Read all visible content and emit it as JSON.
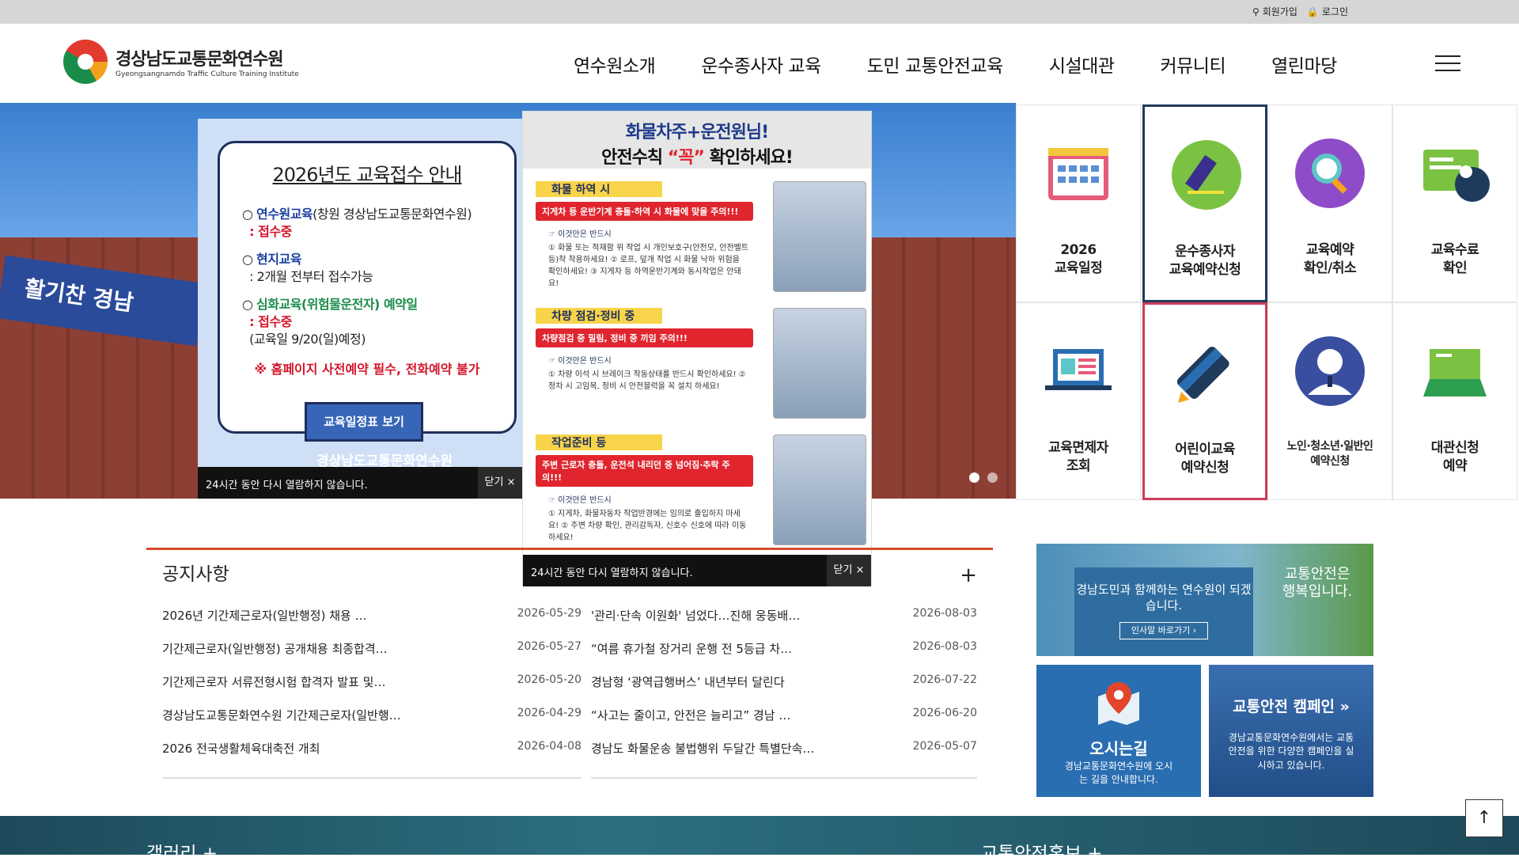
{
  "topbar": {
    "join": "회원가입",
    "login": "로그인"
  },
  "logo": {
    "title": "경상남도교통문화연수원",
    "subtitle": "Gyeongsangnamdo Traffic Culture Training Institute"
  },
  "nav": [
    "연수원소개",
    "운수종사자 교육",
    "도민 교통안전교육",
    "시설대관",
    "커뮤니티",
    "열린마당"
  ],
  "hero": {
    "sign_text": "활기찬 경남"
  },
  "popup1": {
    "title": "2026년도 교육접수 안내",
    "item1_label": "연수원교육",
    "item1_extra": "(창원 경상남도교통문화연수원)",
    "item1_status": ": 접수중",
    "item2_label": "현지교육",
    "item2_status": ": 2개월 전부터 접수가능",
    "item3_label": "심화교육(위험물운전자) 예약일",
    "item3_status": ": 접수중",
    "item3_note": "(교육일 9/20(일)예정)",
    "warning": "※ 홈페이지 사전예약 필수, 전화예약 불가",
    "button": "교육일정표 보기",
    "org": "경상남도교통문화연수원",
    "close_msg": "24시간 동안 다시 열람하지 않습니다.",
    "close_label": "닫기 ×"
  },
  "popup2": {
    "head1": "화물차주+운전원님!",
    "head2_pre": "안전수칙 ",
    "head2_emph": "“꼭”",
    "head2_post": " 확인하세요!",
    "sections": [
      {
        "title": "화물 하역 시",
        "bar": "지게차 등 운반기계 충돌·하역 시 화물에 맞을 주의!!!",
        "sub": "☞ 이것만은 반드시",
        "body": "① 화물 또는 적재함 위 작업 시 개인보호구(안전모, 안전벨트 등)착 착용하세요! ② 로프, 덮개 작업 시 화물 낙하 위험을 확인하세요! ③ 지게차 등 하역운반기계와 동시작업은 안돼요!"
      },
      {
        "title": "차량 점검·정비 중",
        "bar": "차량점검 중 밀림, 정비 중 끼임 주의!!!",
        "sub": "☞ 이것만은 반드시",
        "body": "① 차량 이석 시 브레이크 작동상태를 반드시 확인하세요! ② 정차 시 고임목, 정비 시 안전블럭을 꼭 설치 하세요!"
      },
      {
        "title": "작업준비 등",
        "bar": "주변 근로자 충돌, 운전석 내리던 중 넘어짐·추락 주의!!!",
        "sub": "☞ 이것만은 반드시",
        "body": "① 지게차, 화물자동차 작업반경에는 임의로 출입하지 마세요! ② 주변 차량 확인, 관리감독자, 신호수 신호에 따라 이동 하세요!"
      }
    ],
    "close_msg": "24시간 동안 다시 열람하지 않습니다.",
    "close_label": "닫기 ×"
  },
  "tiles": [
    {
      "label": "2026\n교육일정",
      "icon": "calendar-icon"
    },
    {
      "label": "운수종사자\n교육예약신청",
      "icon": "pencil-circle-icon"
    },
    {
      "label": "교육예약\n확인/취소",
      "icon": "magnifier-icon"
    },
    {
      "label": "교육수료\n확인",
      "icon": "certificate-icon"
    },
    {
      "label": "교육면제자\n조회",
      "icon": "laptop-icon"
    },
    {
      "label": "어린이교육\n예약신청",
      "icon": "crayon-icon"
    },
    {
      "label": "노인·청소년·일반인\n예약신청",
      "icon": "person-icon"
    },
    {
      "label": "대관신청\n예약",
      "icon": "folder-icon"
    }
  ],
  "notice": {
    "title": "공지사항",
    "more": "+",
    "left": [
      {
        "title": "2026년 기간제근로자(일반행정) 채용 …",
        "date": "2026-05-29"
      },
      {
        "title": "기간제근로자(일반행정) 공개채용 최종합격…",
        "date": "2026-05-27"
      },
      {
        "title": "기간제근로자 서류전형시험 합격자 발표 및…",
        "date": "2026-05-20"
      },
      {
        "title": "경상남도교통문화연수원 기간제근로자(일반행…",
        "date": "2026-04-29"
      },
      {
        "title": "2026 전국생활체육대축전 개최",
        "date": "2026-04-08"
      }
    ],
    "right": [
      {
        "title": "'관리·단속 이원화' 넘었다…진해 웅동배…",
        "date": "2026-08-03"
      },
      {
        "title": "“여름 휴가철 장거리 운행 전 5등급 차…",
        "date": "2026-08-03"
      },
      {
        "title": "경남형 ‘광역급행버스’ 내년부터 달린다",
        "date": "2026-07-22"
      },
      {
        "title": "“사고는 줄이고, 안전은 늘리고” 경남 …",
        "date": "2026-06-20"
      },
      {
        "title": "경남도 화물운송 불법행위 두달간 특별단속…",
        "date": "2026-05-07"
      }
    ]
  },
  "banners": {
    "b1_text": "경남도민과 함께하는 연수원이 되겠습니다.",
    "b1_link": "인사말 바로가기  ›",
    "b1_slogan": "교통안전은 행복입니다.",
    "b2_title": "오시는길",
    "b2_sub": "경남교통문화연수원에 오시는 길을 안내합니다.",
    "b3_title": "교통안전 캠페인 »",
    "b3_sub": "경남교통문화연수원에서는 교통안전을 위한 다양한 캠페인을 실시하고 있습니다."
  },
  "footer": {
    "gallery": "갤러리  +",
    "promo": "교통안전홍보  +"
  },
  "totop": "↑"
}
